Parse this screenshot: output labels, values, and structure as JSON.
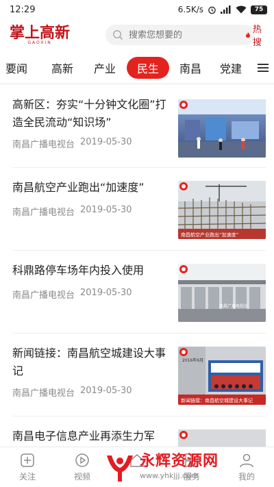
{
  "status_bar": {
    "time": "12:29",
    "network_speed": "6.5K/s",
    "battery": "75"
  },
  "header": {
    "logo_text": "掌上高新",
    "logo_subtext": "GAOXIN",
    "search_placeholder": "搜索您想要的",
    "hot_search_label": "热搜"
  },
  "tabs": [
    {
      "label": "要闻",
      "active": false
    },
    {
      "label": "高新",
      "active": false
    },
    {
      "label": "产业",
      "active": false
    },
    {
      "label": "民生",
      "active": true
    },
    {
      "label": "南昌",
      "active": false
    },
    {
      "label": "党建",
      "active": false
    }
  ],
  "articles": [
    {
      "title": "高新区：夯实“十分钟文化圈”打造全民流动“知识场”",
      "source": "南昌广播电视台",
      "date": "2019-05-30"
    },
    {
      "title": "南昌航空产业跑出“加速度”",
      "source": "南昌广播电视台",
      "date": "2019-05-30"
    },
    {
      "title": "科鼎路停车场年内投入使用",
      "source": "南昌广播电视台",
      "date": "2019-05-30"
    },
    {
      "title": "新闻链接：南昌航空城建设大事记",
      "source": "南昌广播电视台",
      "date": "2019-05-30"
    },
    {
      "title": "南昌电子信息产业再添生力军",
      "source": "",
      "date": ""
    }
  ],
  "thumb_captions": {
    "article_2": "南昌航空产业跑出“加速度”",
    "article_3": "南昌广播电视台",
    "article_4_top": "2016年6月",
    "article_4_bottom": "新闻链接：南昌航空城建设大事记"
  },
  "bottom_nav": [
    {
      "label": "关注",
      "icon": "plus-box-icon"
    },
    {
      "label": "视频",
      "icon": "play-circle-icon"
    },
    {
      "label": "",
      "icon": "home-icon"
    },
    {
      "label": "服务",
      "icon": "grid-icon"
    },
    {
      "label": "我的",
      "icon": "user-icon"
    }
  ],
  "watermark": {
    "text": "永辉资源网",
    "url": "www.yhkjjj.com"
  },
  "colors": {
    "brand_red": "#e4231e",
    "logo_red": "#c0151b",
    "text_gray": "#8a8a8a"
  }
}
